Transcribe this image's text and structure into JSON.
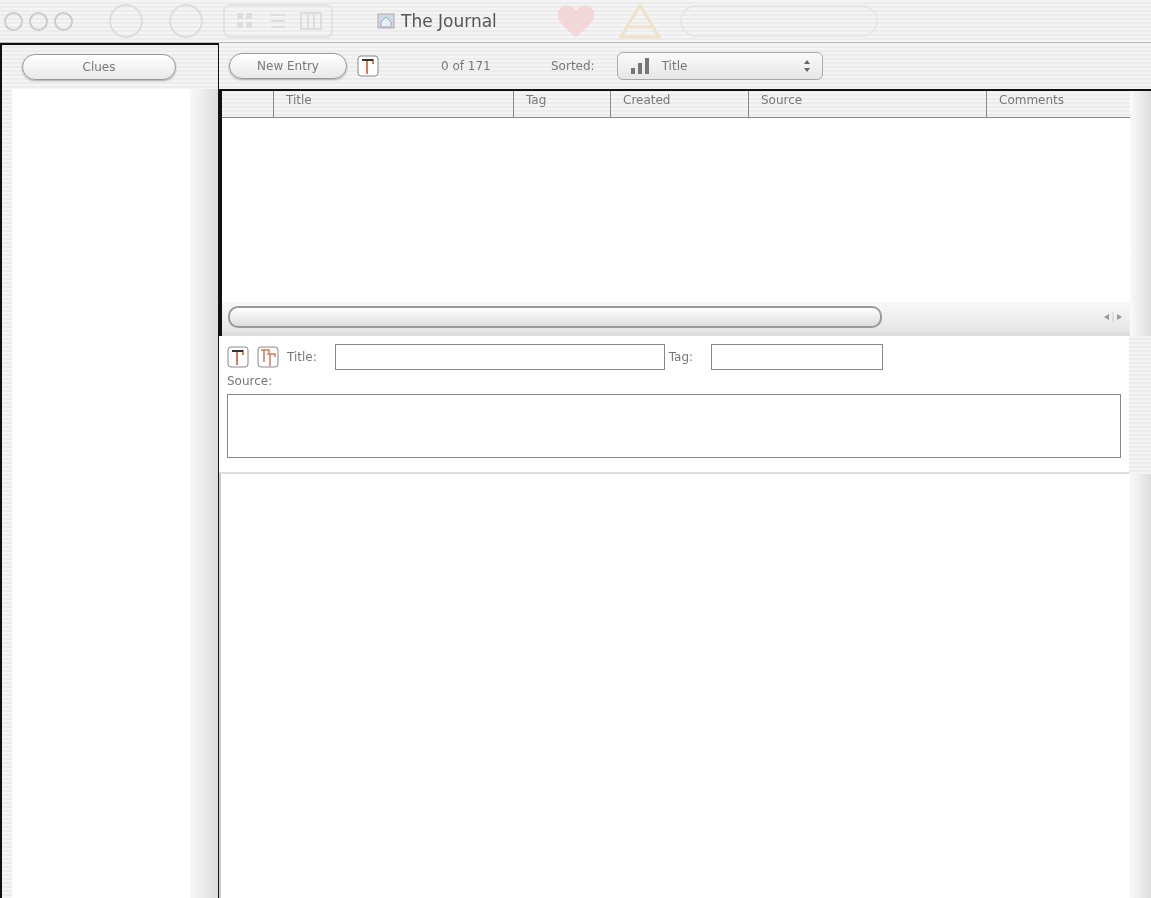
{
  "window": {
    "title": "The Journal"
  },
  "sidebar": {
    "button": "Clues"
  },
  "toolbar": {
    "new_entry": "New Entry",
    "count": "0 of 171",
    "sort_label": "Sorted:",
    "sort_value": "Title"
  },
  "table": {
    "columns": [
      "Title",
      "Tag",
      "Created",
      "Source",
      "Comments"
    ]
  },
  "form": {
    "title_label": "Title:",
    "tag_label": "Tag:",
    "source_label": "Source:"
  }
}
